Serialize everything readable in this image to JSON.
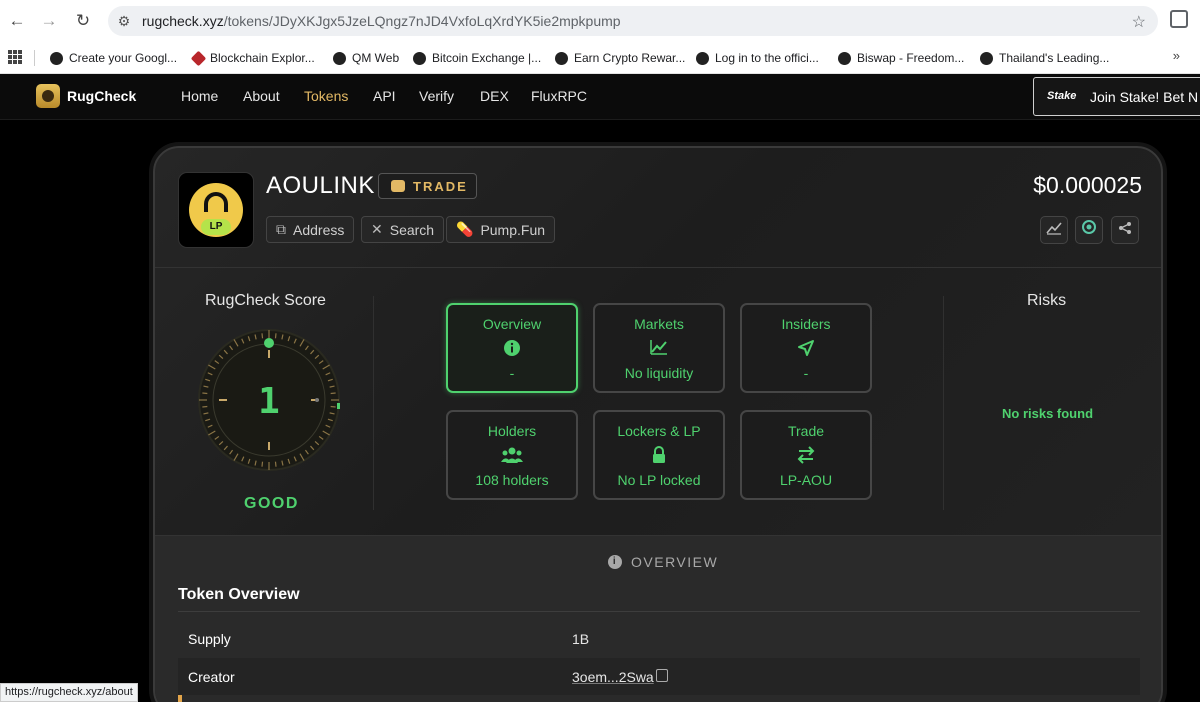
{
  "browser": {
    "url_domain": "rugcheck.xyz",
    "url_path": "/tokens/JDyXKJgx5JzeLQngz7nJD4VxfoLqXrdYK5ie2mpkpump",
    "bookmarks": [
      "Create your Googl...",
      "Blockchain Explor...",
      "QM Web",
      "Bitcoin Exchange |...",
      "Earn Crypto Rewar...",
      "Log in to the offici...",
      "Biswap - Freedom...",
      "Thailand's Leading..."
    ],
    "more_bookmarks": "»",
    "status_url": "https://rugcheck.xyz/about"
  },
  "site": {
    "logo": "RugCheck",
    "nav": [
      "Home",
      "About",
      "Tokens",
      "API",
      "Verify",
      "DEX",
      "FluxRPC"
    ],
    "active_nav": "Tokens",
    "banner_logo": "Stake",
    "banner_text": "Join Stake! Bet N"
  },
  "token": {
    "name": "AOULINK",
    "badge": "TRADE",
    "logo_badge": "LP",
    "price": "$0.000025",
    "chips": [
      "Address",
      "Search",
      "Pump.Fun"
    ]
  },
  "score": {
    "title": "RugCheck Score",
    "value": "1",
    "label": "GOOD"
  },
  "tiles": [
    {
      "title": "Overview",
      "value": "-",
      "icon": "info-icon"
    },
    {
      "title": "Markets",
      "value": "No liquidity",
      "icon": "chart-icon"
    },
    {
      "title": "Insiders",
      "value": "-",
      "icon": "send-icon"
    },
    {
      "title": "Holders",
      "value": "108 holders",
      "icon": "users-icon"
    },
    {
      "title": "Lockers & LP",
      "value": "No LP locked",
      "icon": "lock-icon"
    },
    {
      "title": "Trade",
      "value": "LP-AOU",
      "icon": "swap-icon"
    }
  ],
  "risks": {
    "title": "Risks",
    "message": "No risks found"
  },
  "overview": {
    "section_label": "OVERVIEW",
    "title": "Token Overview",
    "rows": [
      {
        "key": "Supply",
        "value": "1B"
      },
      {
        "key": "Creator",
        "value": "3oem...2Swa"
      }
    ]
  },
  "colors": {
    "accent_green": "#4fd16e",
    "accent_gold": "#e3b965"
  }
}
